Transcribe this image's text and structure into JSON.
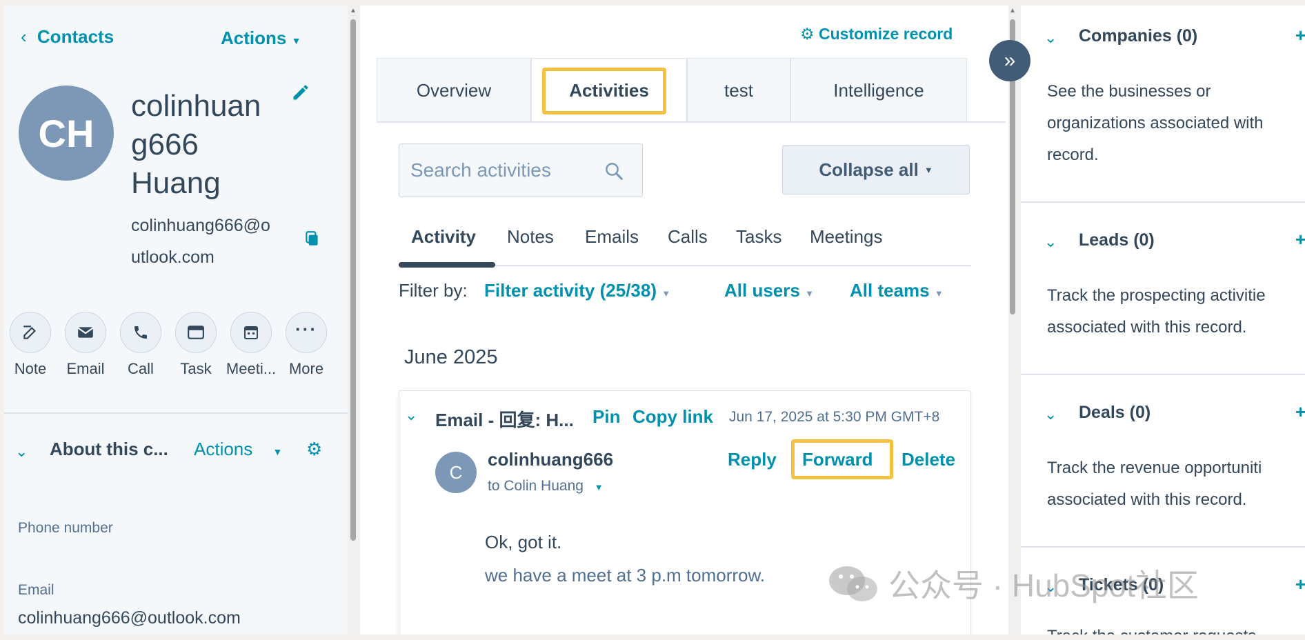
{
  "left": {
    "back_label": "Contacts",
    "actions_label": "Actions",
    "avatar_initials": "CH",
    "name_line1": "colinhuan",
    "name_line2": "g666",
    "name_line3": "Huang",
    "email_line1": "colinhuang666@o",
    "email_line2": "utlook.com",
    "quick_actions": [
      {
        "label": "Note",
        "icon": "note-icon"
      },
      {
        "label": "Email",
        "icon": "email-icon"
      },
      {
        "label": "Call",
        "icon": "call-icon"
      },
      {
        "label": "Task",
        "icon": "task-icon"
      },
      {
        "label": "Meeti...",
        "icon": "meeting-icon"
      },
      {
        "label": "More",
        "icon": "more-icon"
      }
    ],
    "about_title": "About this c...",
    "about_actions": "Actions",
    "phone_label": "Phone number",
    "email_label": "Email",
    "email_value": "colinhuang666@outlook.com"
  },
  "middle": {
    "customize_label": "Customize record",
    "tabs": [
      "Overview",
      "Activities",
      "test",
      "Intelligence"
    ],
    "search_placeholder": "Search activities",
    "collapse_label": "Collapse all",
    "subtabs": [
      "Activity",
      "Notes",
      "Emails",
      "Calls",
      "Tasks",
      "Meetings"
    ],
    "filter_by": "Filter by:",
    "filter_activity": "Filter activity (25/38)",
    "all_users": "All users",
    "all_teams": "All teams",
    "month": "June 2025",
    "email_card": {
      "title": "Email - 回复: H...",
      "pin": "Pin",
      "copy_link": "Copy link",
      "timestamp": "Jun 17, 2025 at 5:30 PM GMT+8",
      "avatar": "C",
      "sender": "colinhuang666",
      "to_prefix": "to",
      "to_name": "Colin Huang",
      "reply": "Reply",
      "forward": "Forward",
      "delete": "Delete",
      "body_line1": "Ok, got it.",
      "body_line2": "we have a meet at 3 p.m tomorrow."
    }
  },
  "right": {
    "cards": [
      {
        "title": "Companies (0)",
        "text1": "See the businesses or",
        "text2": "organizations associated with",
        "text3": "record."
      },
      {
        "title": "Leads (0)",
        "text1": "Track the prospecting activitie",
        "text2": "associated with this record."
      },
      {
        "title": "Deals (0)",
        "text1": "Track the revenue opportuniti",
        "text2": "associated with this record."
      },
      {
        "title": "Tickets (0)",
        "text1": "Track the customer requests"
      }
    ]
  },
  "watermark": "公众号 · HubSpot社区",
  "colors": {
    "accent": "#0091ae",
    "highlight": "#f5c142",
    "avatar": "#7c98b6",
    "toggle": "#425b76"
  }
}
